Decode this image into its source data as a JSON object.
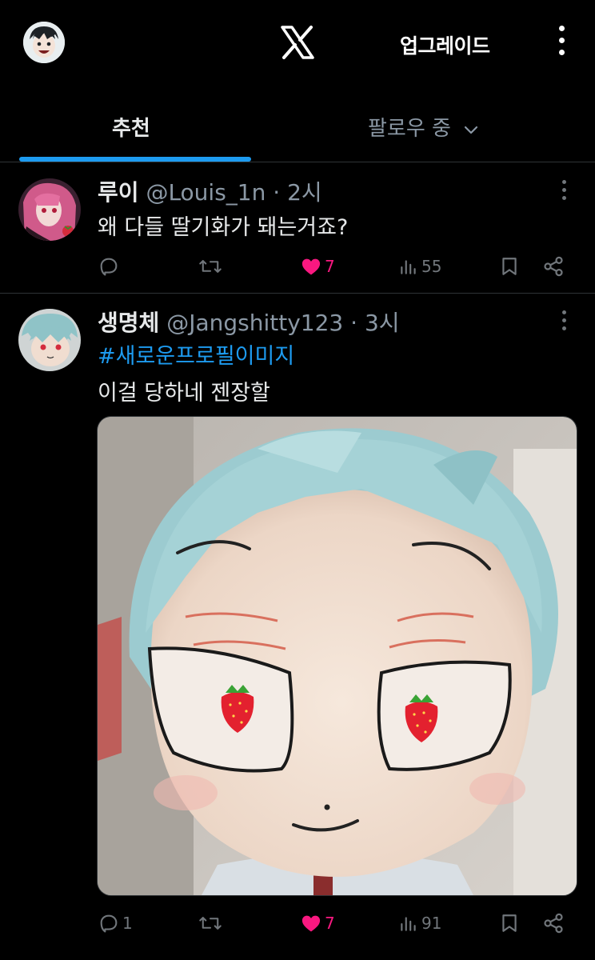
{
  "header": {
    "logo_icon": "x-logo-icon",
    "upgrade_label": "업그레이드",
    "more_icon": "vertical-ellipsis-icon"
  },
  "tabs": [
    {
      "label": "추천",
      "active": true
    },
    {
      "label": "팔로우 중",
      "active": false,
      "icon": "chevron-down-icon"
    }
  ],
  "tweets": [
    {
      "name": "루이",
      "handle": "@Louis_1n",
      "time": "2시",
      "text": "왜 다들 딸기화가 돼는거죠?",
      "replies": "",
      "retweets": "",
      "likes": "7",
      "liked": true,
      "views": "55"
    },
    {
      "name": "생명체",
      "handle": "@Jangshitty123",
      "time": "3시",
      "hashtag": "#새로운프로필이미지",
      "text": "이걸 당하네 젠장할",
      "replies": "1",
      "retweets": "",
      "likes": "7",
      "liked": true,
      "views": "91"
    }
  ],
  "colors": {
    "background": "#000000",
    "accent": "#1d9bf0",
    "like": "#f91880",
    "muted": "#71767b",
    "divider": "#2f3336"
  }
}
